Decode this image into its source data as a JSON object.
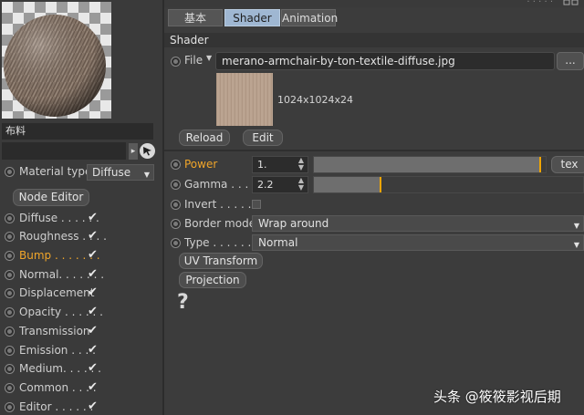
{
  "material": {
    "name": "布料",
    "search_value": "",
    "type_label": "Material type",
    "type_value": "Diffuse",
    "node_editor_label": "Node Editor",
    "channels": [
      {
        "label": "Diffuse . . . . . .",
        "checked": true,
        "active": false
      },
      {
        "label": "Roughness . . . .",
        "checked": true,
        "active": false
      },
      {
        "label": "Bump . . . . . . .",
        "checked": true,
        "active": true
      },
      {
        "label": "Normal. . . . . . .",
        "checked": true,
        "active": false
      },
      {
        "label": "Displacement",
        "checked": true,
        "active": false
      },
      {
        "label": "Opacity . . . . . .",
        "checked": true,
        "active": false
      },
      {
        "label": "Transmission",
        "checked": true,
        "active": false
      },
      {
        "label": "Emission . . . .",
        "checked": true,
        "active": false
      },
      {
        "label": "Medium. . . . . .",
        "checked": true,
        "active": false
      },
      {
        "label": "Common . . . .",
        "checked": true,
        "active": false
      },
      {
        "label": "Editor . . . . . .",
        "checked": true,
        "active": false
      }
    ]
  },
  "tabs": [
    {
      "label": "基本",
      "selected": false
    },
    {
      "label": "Shader",
      "selected": true
    },
    {
      "label": "Animation",
      "selected": false
    }
  ],
  "shader": {
    "section_title": "Shader",
    "file_label": "File",
    "file_value": "merano-armchair-by-ton-textile-diffuse.jpg",
    "browse_label": "...",
    "image_size": "1024x1024x24",
    "reload_label": "Reload",
    "edit_label": "Edit",
    "power_label": "Power",
    "power_value": "1.",
    "power_level": 0.98,
    "tex_label": "tex",
    "gamma_label": "Gamma . . . .",
    "gamma_value": "2.2",
    "gamma_level": 0.25,
    "invert_label": "Invert . . . . . .",
    "border_mode_label": "Border mode",
    "border_mode_value": "Wrap around",
    "type_label": "Type . . . . . . .",
    "type_value": "Normal",
    "uv_transform_label": "UV Transform",
    "projection_label": "Projection",
    "help_glyph": "?"
  },
  "watermark": "头条 @筱筱影视后期",
  "colors": {
    "accent": "#f0a52a",
    "tab_selected": "#9fb7d2",
    "panel": "#3c3c3c"
  }
}
